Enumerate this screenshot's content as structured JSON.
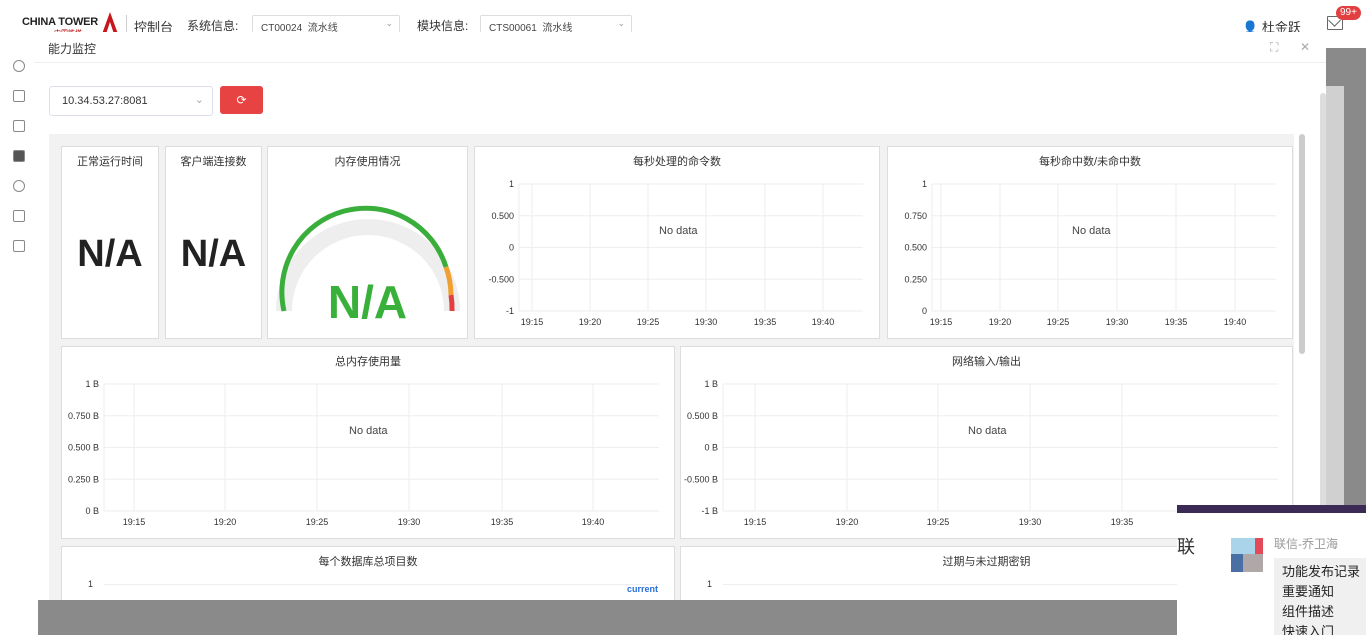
{
  "header": {
    "logo_text": "CHINA TOWER",
    "logo_sub": "中国铁塔",
    "console": "控制台",
    "system_label": "系统信息:",
    "system_value": "CT00024_流水线",
    "module_label": "模块信息:",
    "module_value": "CTS00061_流水线",
    "user": "杜金跃",
    "mail_badge": "99+"
  },
  "sidebar": {
    "icons": [
      "user-icon",
      "document-icon",
      "camera-icon",
      "grid-icon",
      "at-icon",
      "printer-icon",
      "monitor-icon"
    ]
  },
  "modal": {
    "title": "能力监控",
    "server": "10.34.53.27:8081",
    "refresh_icon": "refresh-icon"
  },
  "panels": {
    "uptime": {
      "title": "正常运行时间",
      "value": "N/A"
    },
    "clients": {
      "title": "客户端连接数",
      "value": "N/A"
    },
    "memory": {
      "title": "内存使用情况",
      "value": "N/A"
    },
    "commands": {
      "title": "每秒处理的命令数",
      "empty": "No data"
    },
    "hits": {
      "title": "每秒命中数/未命中数",
      "empty": "No data"
    },
    "total_mem": {
      "title": "总内存使用量",
      "empty": "No data"
    },
    "network": {
      "title": "网络输入/输出",
      "empty": "No data"
    },
    "db_items": {
      "title": "每个数据库总项目数",
      "legend": "current"
    },
    "keys": {
      "title": "过期与未过期密钥"
    }
  },
  "chart_data": [
    {
      "type": "line",
      "title": "每秒处理的命令数",
      "x": [
        "19:15",
        "19:20",
        "19:25",
        "19:30",
        "19:35",
        "19:40"
      ],
      "yticks": [
        "1",
        "0.500",
        "0",
        "-0.500",
        "-1"
      ],
      "ylim": [
        -1,
        1
      ],
      "series": []
    },
    {
      "type": "line",
      "title": "每秒命中数/未命中数",
      "x": [
        "19:15",
        "19:20",
        "19:25",
        "19:30",
        "19:35",
        "19:40"
      ],
      "yticks": [
        "1",
        "0.750",
        "0.500",
        "0.250",
        "0"
      ],
      "ylim": [
        0,
        1
      ],
      "series": []
    },
    {
      "type": "line",
      "title": "总内存使用量",
      "x": [
        "19:15",
        "19:20",
        "19:25",
        "19:30",
        "19:35",
        "19:40"
      ],
      "yticks": [
        "1 B",
        "0.750 B",
        "0.500 B",
        "0.250 B",
        "0 B"
      ],
      "ylim": [
        0,
        1
      ],
      "series": []
    },
    {
      "type": "line",
      "title": "网络输入/输出",
      "x": [
        "19:15",
        "19:20",
        "19:25",
        "19:30",
        "19:35"
      ],
      "yticks": [
        "1 B",
        "0.500 B",
        "0 B",
        "-0.500 B",
        "-1 B"
      ],
      "ylim": [
        -1,
        1
      ],
      "series": []
    }
  ],
  "popup": {
    "lian": "联",
    "from": "联信-乔卫海",
    "menu": [
      "功能发布记录",
      "重要通知",
      "组件描述",
      "快速入门"
    ]
  }
}
